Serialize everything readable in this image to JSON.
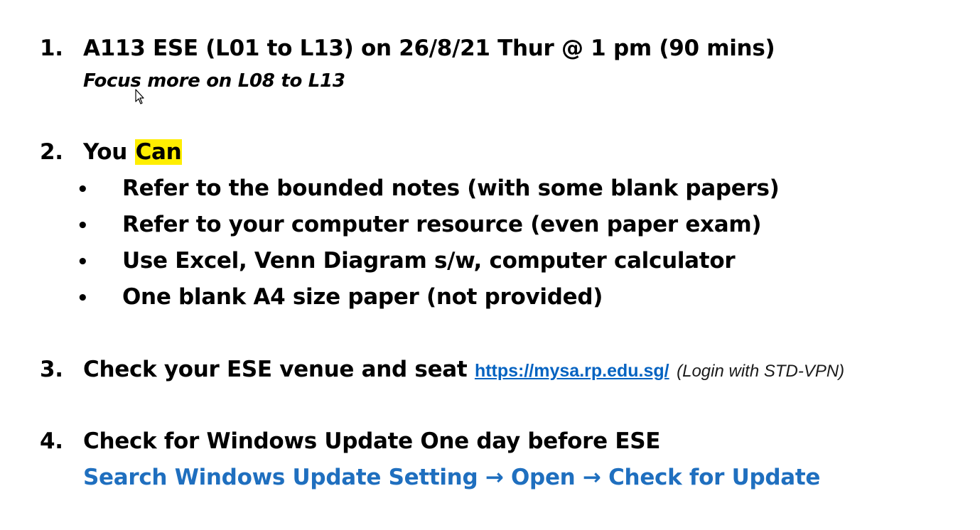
{
  "items": [
    {
      "number": "1.",
      "text": "A113 ESE (L01 to L13) on 26/8/21 Thur @ 1 pm (90 mins)",
      "subtext": "Focus more on L08 to L13"
    },
    {
      "number": "2.",
      "prefix": "You ",
      "highlight": "Can",
      "highlight_color": "#ffee00",
      "bullets": [
        "Refer to the bounded notes (with some blank papers)",
        "Refer to your computer resource (even paper exam)",
        "Use Excel, Venn Diagram s/w, computer calculator",
        "One blank A4 size paper (not provided)"
      ],
      "bullet_glyph": "•"
    },
    {
      "number": "3.",
      "text": "Check your ESE venue and seat ",
      "link": "https://mysa.rp.edu.sg/",
      "link_color": "#0563c1",
      "note": "(Login with STD-VPN)"
    },
    {
      "number": "4.",
      "text": "Check for Windows Update One day before ESE",
      "subtext": "Search Windows Update Setting → Open → Check for Update",
      "subtext_color": "#1f6fbf"
    }
  ],
  "cursor_icon": "mouse-pointer-icon"
}
